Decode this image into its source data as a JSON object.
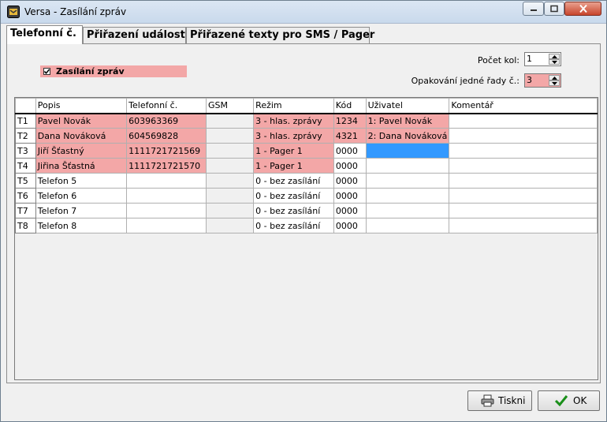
{
  "window": {
    "title": "Versa - Zasílání zpráv"
  },
  "tabs": [
    {
      "label": "Telefonní č."
    },
    {
      "label": "Přiřazení událostí"
    },
    {
      "label": "Přiřazené texty pro SMS / Pager"
    }
  ],
  "settings": {
    "enable_label": "Zasílání zpráv",
    "enabled": true,
    "rounds_label": "Počet kol:",
    "rounds_value": "1",
    "repeat_label": "Opakování jedné řady č.:",
    "repeat_value": "3"
  },
  "table": {
    "headers": [
      "",
      "Popis",
      "Telefonní č.",
      "GSM",
      "Režim",
      "Kód",
      "Uživatel",
      "Komentář"
    ],
    "rows": [
      {
        "id": "T1",
        "popis": "Pavel Novák",
        "tel": "603963369",
        "gsm": "",
        "rezim": "3 - hlas. zprávy",
        "kod": "1234",
        "uzivatel": "1: Pavel Novák",
        "komentar": ""
      },
      {
        "id": "T2",
        "popis": "Dana Nováková",
        "tel": "604569828",
        "gsm": "",
        "rezim": "3 - hlas. zprávy",
        "kod": "4321",
        "uzivatel": "2: Dana Nováková",
        "komentar": ""
      },
      {
        "id": "T3",
        "popis": "Jiří Šťastný",
        "tel": "1111721721569",
        "gsm": "",
        "rezim": "1 - Pager 1",
        "kod": "0000",
        "uzivatel": "",
        "komentar": ""
      },
      {
        "id": "T4",
        "popis": "Jiřina Šťastná",
        "tel": "1111721721570",
        "gsm": "",
        "rezim": "1 - Pager 1",
        "kod": "0000",
        "uzivatel": "",
        "komentar": ""
      },
      {
        "id": "T5",
        "popis": "Telefon 5",
        "tel": "",
        "gsm": "",
        "rezim": "0 - bez zasílání",
        "kod": "0000",
        "uzivatel": "",
        "komentar": ""
      },
      {
        "id": "T6",
        "popis": "Telefon 6",
        "tel": "",
        "gsm": "",
        "rezim": "0 - bez zasílání",
        "kod": "0000",
        "uzivatel": "",
        "komentar": ""
      },
      {
        "id": "T7",
        "popis": "Telefon 7",
        "tel": "",
        "gsm": "",
        "rezim": "0 - bez zasílání",
        "kod": "0000",
        "uzivatel": "",
        "komentar": ""
      },
      {
        "id": "T8",
        "popis": "Telefon 8",
        "tel": "",
        "gsm": "",
        "rezim": "0 - bez zasílání",
        "kod": "0000",
        "uzivatel": "",
        "komentar": ""
      }
    ]
  },
  "buttons": {
    "print_label": "Tiskni",
    "ok_label": "OK"
  },
  "colors": {
    "highlight": "#f3a7a7",
    "selection": "#3399ff"
  },
  "icons": {
    "app": "versa-app-icon",
    "print": "printer-icon",
    "ok": "checkmark-icon"
  }
}
